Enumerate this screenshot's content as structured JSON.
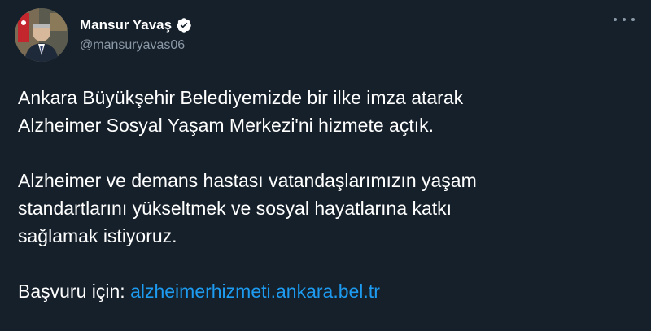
{
  "author": {
    "name": "Mansur Yavaş",
    "handle": "@mansuryavas06",
    "verified": true,
    "avatar_icon": "profile-photo",
    "verified_icon": "verified-badge-icon"
  },
  "menu": {
    "icon": "more-options-icon"
  },
  "tweet": {
    "line1": "Ankara Büyükşehir Belediyemizde bir ilke imza atarak",
    "line2": "Alzheimer Sosyal Yaşam Merkezi'ni hizmete açtık.",
    "line3": "Alzheimer ve demans hastası vatandaşlarımızın yaşam",
    "line4": "standartlarını yükseltmek ve sosyal hayatlarına katkı",
    "line5": "sağlamak istiyoruz.",
    "apply_label": "Başvuru için:",
    "apply_link": "alzheimerhizmeti.ankara.bel.tr"
  },
  "colors": {
    "background": "#15202b",
    "text": "#ffffff",
    "secondary_text": "#8b98a5",
    "link": "#1d9bf0",
    "verified": "#1d9bf0"
  }
}
